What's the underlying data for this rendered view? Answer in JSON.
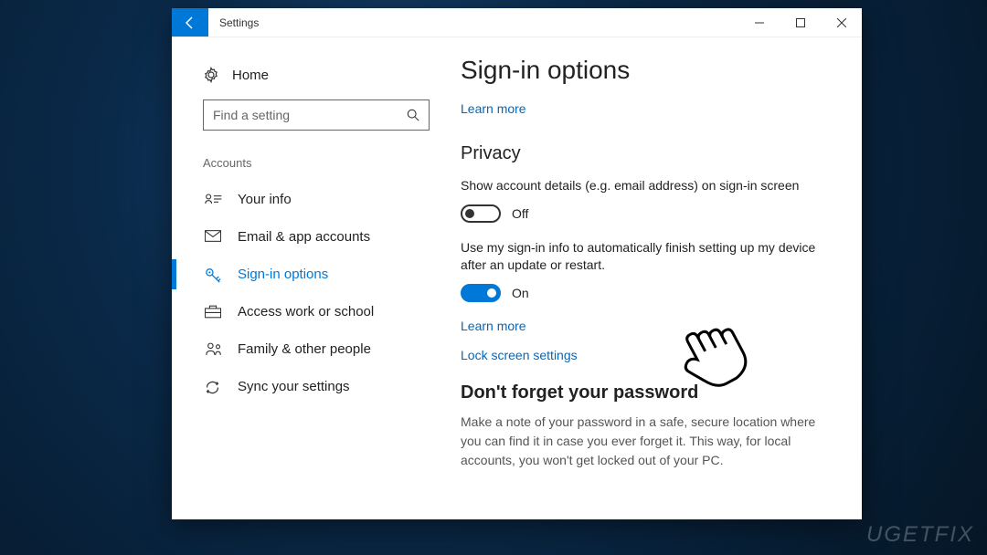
{
  "window": {
    "title": "Settings"
  },
  "sidebar": {
    "home_label": "Home",
    "search_placeholder": "Find a setting",
    "group_header": "Accounts",
    "items": [
      {
        "label": "Your info"
      },
      {
        "label": "Email & app accounts"
      },
      {
        "label": "Sign-in options"
      },
      {
        "label": "Access work or school"
      },
      {
        "label": "Family & other people"
      },
      {
        "label": "Sync your settings"
      }
    ]
  },
  "content": {
    "page_title": "Sign-in options",
    "learn_more_top": "Learn more",
    "privacy_title": "Privacy",
    "privacy_setting1_desc": "Show account details (e.g. email address) on sign-in screen",
    "privacy_setting1_state": "Off",
    "privacy_setting2_desc": "Use my sign-in info to automatically finish setting up my device after an update or restart.",
    "privacy_setting2_state": "On",
    "learn_more_bottom": "Learn more",
    "lock_screen_link": "Lock screen settings",
    "password_title": "Don't forget your password",
    "password_desc": "Make a note of your password in a safe, secure location where you can find it in case you ever forget it. This way, for local accounts, you won't get locked out of your PC."
  },
  "watermark": "UGETFIX"
}
